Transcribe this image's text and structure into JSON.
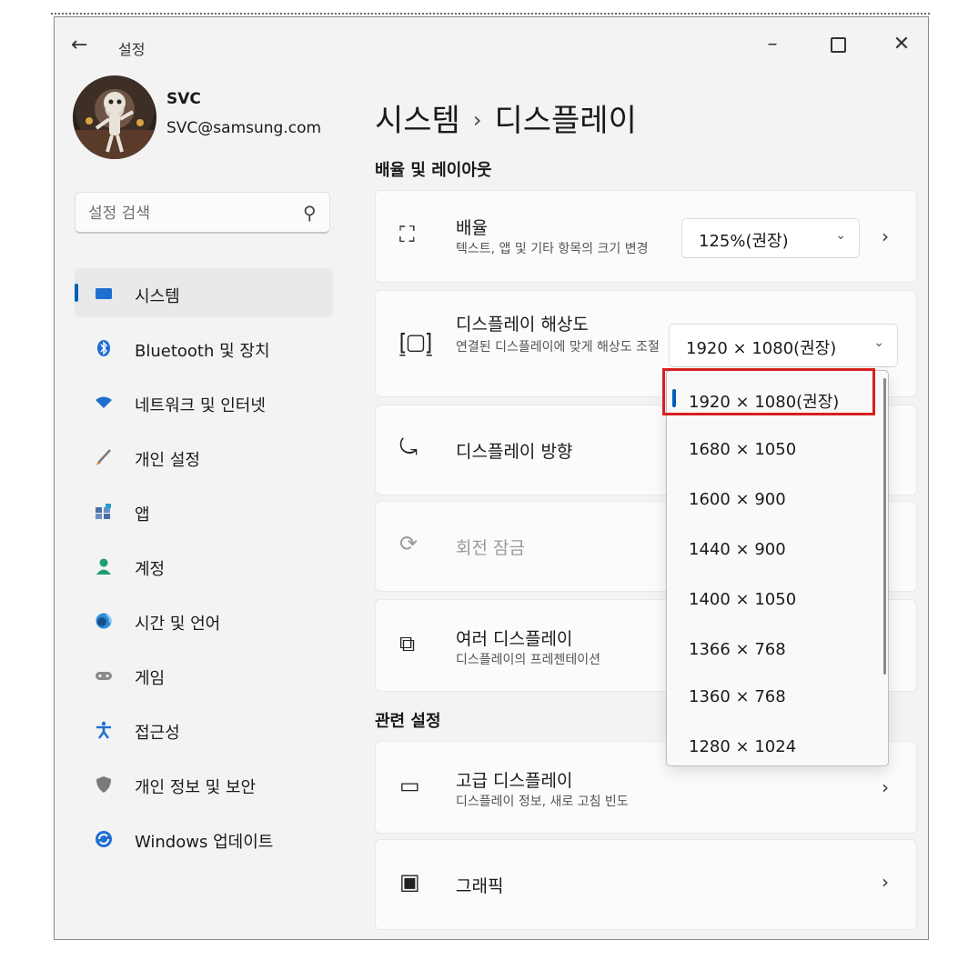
{
  "window": {
    "title": "설정",
    "back_icon": "back-arrow-icon",
    "minimize": "–",
    "close": "✕"
  },
  "user": {
    "name": "SVC",
    "email": "SVC@samsung.com"
  },
  "search": {
    "placeholder": "설정 검색",
    "icon": "search-icon"
  },
  "sidebar": {
    "items": [
      {
        "label": "시스템",
        "icon": "system-icon",
        "color": "#1f6fd1",
        "active": true
      },
      {
        "label": "Bluetooth 및 장치",
        "icon": "bluetooth-icon",
        "color": "#1f6fd1"
      },
      {
        "label": "네트워크 및 인터넷",
        "icon": "wifi-icon",
        "color": "#1f6fd1"
      },
      {
        "label": "개인 설정",
        "icon": "brush-icon",
        "color": "#d07a2a"
      },
      {
        "label": "앱",
        "icon": "apps-icon",
        "color": "#4a6fa5"
      },
      {
        "label": "계정",
        "icon": "account-icon",
        "color": "#1f9e6e"
      },
      {
        "label": "시간 및 언어",
        "icon": "globe-clock-icon",
        "color": "#2a8fd8"
      },
      {
        "label": "게임",
        "icon": "gamepad-icon",
        "color": "#8a8a8a"
      },
      {
        "label": "접근성",
        "icon": "accessibility-icon",
        "color": "#1f6fd1"
      },
      {
        "label": "개인 정보 및 보안",
        "icon": "shield-icon",
        "color": "#7a7a7a"
      },
      {
        "label": "Windows 업데이트",
        "icon": "update-icon",
        "color": "#1f6fd1"
      }
    ]
  },
  "main": {
    "breadcrumb_parent": "시스템",
    "breadcrumb_sep": "›",
    "breadcrumb_current": "디스플레이",
    "section_layout": "배율 및 레이아웃",
    "section_related": "관련 설정",
    "scale": {
      "title": "배율",
      "subtitle": "텍스트, 앱 및 기타 항목의 크기 변경",
      "value": "125%(권장)"
    },
    "resolution": {
      "title": "디스플레이 해상도",
      "subtitle": "연결된 디스플레이에 맞게 해상도 조절",
      "value": "1920 × 1080(권장)"
    },
    "orientation": {
      "title": "디스플레이 방향"
    },
    "rotation_lock": {
      "title": "회전 잠금"
    },
    "multiple": {
      "title": "여러 디스플레이",
      "subtitle": "디스플레이의 프레젠테이션"
    },
    "advanced": {
      "title": "고급 디스플레이",
      "subtitle": "디스플레이 정보, 새로 고침 빈도"
    },
    "graphics": {
      "title": "그래픽"
    }
  },
  "resolution_dropdown": {
    "options": [
      "1920 × 1080(권장)",
      "1680 × 1050",
      "1600 × 900",
      "1440 × 900",
      "1400 × 1050",
      "1366 × 768",
      "1360 × 768",
      "1280 × 1024"
    ],
    "selected_index": 0,
    "highlight_color": "#d61f1f"
  },
  "colors": {
    "accent": "#005fb8",
    "background": "#f3f3f3",
    "card": "#fbfbfb"
  }
}
